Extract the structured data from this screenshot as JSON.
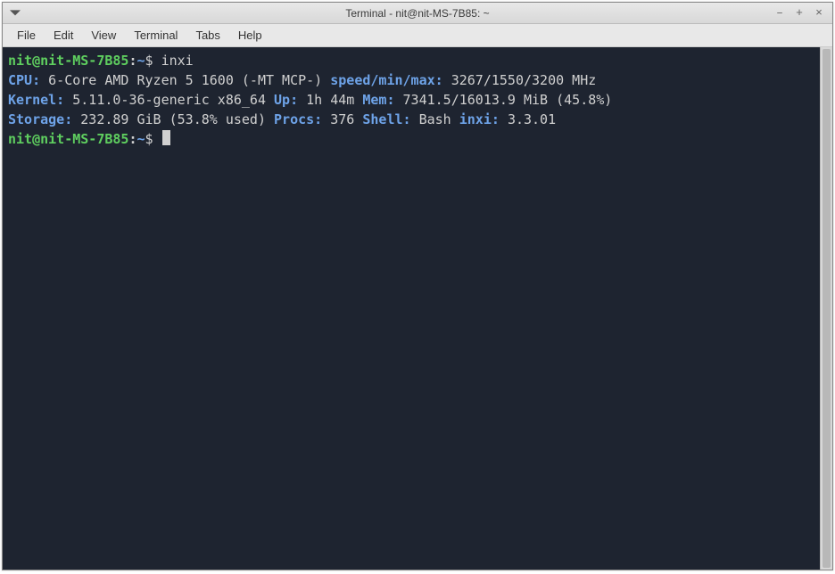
{
  "titlebar": {
    "title": "Terminal - nit@nit-MS-7B85: ~",
    "minimize": "–",
    "maximize": "+",
    "close": "×"
  },
  "menubar": {
    "items": [
      "File",
      "Edit",
      "View",
      "Terminal",
      "Tabs",
      "Help"
    ]
  },
  "prompt": {
    "user_host": "nit@nit-MS-7B85",
    "sep": ":",
    "path": "~",
    "symbol": "$"
  },
  "command": "inxi",
  "inxi": {
    "cpu_label": "CPU:",
    "cpu_value": "6-Core AMD Ryzen 5 1600 (-MT MCP-)",
    "speed_label": "speed/min/max:",
    "speed_value": "3267/1550/3200 MHz",
    "kernel_label": "Kernel:",
    "kernel_value": "5.11.0-36-generic x86_64",
    "up_label": "Up:",
    "up_value": "1h 44m",
    "mem_label": "Mem:",
    "mem_value": "7341.5/16013.9 MiB (45.8%)",
    "storage_label": "Storage:",
    "storage_value": "232.89 GiB (53.8% used)",
    "procs_label": "Procs:",
    "procs_value": "376",
    "shell_label": "Shell:",
    "shell_value": "Bash",
    "inxi_label": "inxi:",
    "inxi_value": "3.3.01"
  }
}
